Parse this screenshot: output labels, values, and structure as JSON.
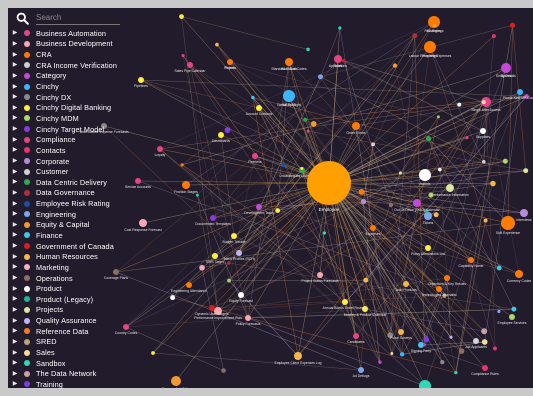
{
  "search": {
    "placeholder": "Search"
  },
  "legend": [
    {
      "label": "Business Automation",
      "color": "#e8438a"
    },
    {
      "label": "Business Development",
      "color": "#f4a9b0"
    },
    {
      "label": "CRA",
      "color": "#ff7a00"
    },
    {
      "label": "CRA Income Verification",
      "color": "#cfcfcf"
    },
    {
      "label": "Category",
      "color": "#c34ad8"
    },
    {
      "label": "Cinchy",
      "color": "#3ab6ff"
    },
    {
      "label": "Cinchy DX",
      "color": "#8a8a8a"
    },
    {
      "label": "Cinchy Digital Banking",
      "color": "#ffef3a"
    },
    {
      "label": "Cinchy MDM",
      "color": "#a7d86a"
    },
    {
      "label": "Cinchy Target Model",
      "color": "#8a3ad8"
    },
    {
      "label": "Compliance",
      "color": "#e6447f"
    },
    {
      "label": "Contacts",
      "color": "#e8336c"
    },
    {
      "label": "Corporate",
      "color": "#b78cd6"
    },
    {
      "label": "Customer",
      "color": "#d4d4d4"
    },
    {
      "label": "Data Centric Delivery",
      "color": "#2fa84f"
    },
    {
      "label": "Data Governance",
      "color": "#b13036"
    },
    {
      "label": "Employee Risk Rating",
      "color": "#1f4e9c"
    },
    {
      "label": "Engineering",
      "color": "#7ea6ee"
    },
    {
      "label": "Equity & Capital",
      "color": "#f39a2c"
    },
    {
      "label": "Finance",
      "color": "#40c8e8"
    },
    {
      "label": "Government of Canada",
      "color": "#d62020"
    },
    {
      "label": "Human Resources",
      "color": "#f5b64a"
    },
    {
      "label": "Marketing",
      "color": "#f4b2c6"
    },
    {
      "label": "Operations",
      "color": "#8d6e63"
    },
    {
      "label": "Product",
      "color": "#ffffff"
    },
    {
      "label": "Product (Legacy)",
      "color": "#1fb59a"
    },
    {
      "label": "Projects",
      "color": "#d9e7a0"
    },
    {
      "label": "Quality Assurance",
      "color": "#c1b7f0"
    },
    {
      "label": "Reference Data",
      "color": "#f47c20"
    },
    {
      "label": "SRED",
      "color": "#b8a57a"
    },
    {
      "label": "Sales",
      "color": "#f7dca0"
    },
    {
      "label": "Sandbox",
      "color": "#2ed8b8"
    },
    {
      "label": "The Data Network",
      "color": "#c7a1a1"
    },
    {
      "label": "Training",
      "color": "#7a3fd8"
    }
  ],
  "graph": {
    "center_label": "Employee",
    "node_labels": [
      "Risk Ratings",
      "Labour Recruiting Expenses",
      "Entity Details",
      "Standard Global Codes",
      "Projects",
      "Applications",
      "MSDOC",
      "Single User Access",
      "Pipelines",
      "Sales Pipe Calendar",
      "Account Contacts",
      "Order Forms",
      "Dashboards",
      "Suppliers",
      "Work Labour Expense Forecasts",
      "Loyalty",
      "Peerless",
      "Position Stages",
      "Service Accounts",
      "Cost Response Forecast",
      "Uncatalogued Lead Forecasts",
      "Awards",
      "Out Of Office (OOO) Calendar",
      "Tickets",
      "Skill Experience",
      "Performance Information",
      "Policy Attestations List",
      "Capability Name",
      "Objectives & Key Results",
      "Currency Codes",
      "Documented Templates",
      "Talent Profiles (RCH)",
      "SWS Target",
      "Engineering Attendance",
      "Equity Forecast",
      "Performance Improvement Plan",
      "Dynamic User Targets",
      "Policy Forecasts",
      "Project Status Forecasts",
      "Annual Bonus Sheet Reviews",
      "Monthly & Product Calendar",
      "Tech Products",
      "Technologies Journalist",
      "Employee Client Expenses Log",
      "Candidates",
      "Pulse Surveys",
      "Signing Party",
      "Job Applicants",
      "Employee Services",
      "Absence And Sales",
      "Country Codes",
      "Coverage Plans",
      "Content Rules",
      "Compliance Rules",
      "Ad Debugs",
      "Interviews",
      "Phone Kind MP Codes",
      "Expenses",
      "Development Tasks",
      "Budget Tracker",
      "Changes",
      "Properties",
      "Sprints",
      "Work Data",
      "Prices",
      "Roles",
      "Global Spotlight"
    ]
  }
}
